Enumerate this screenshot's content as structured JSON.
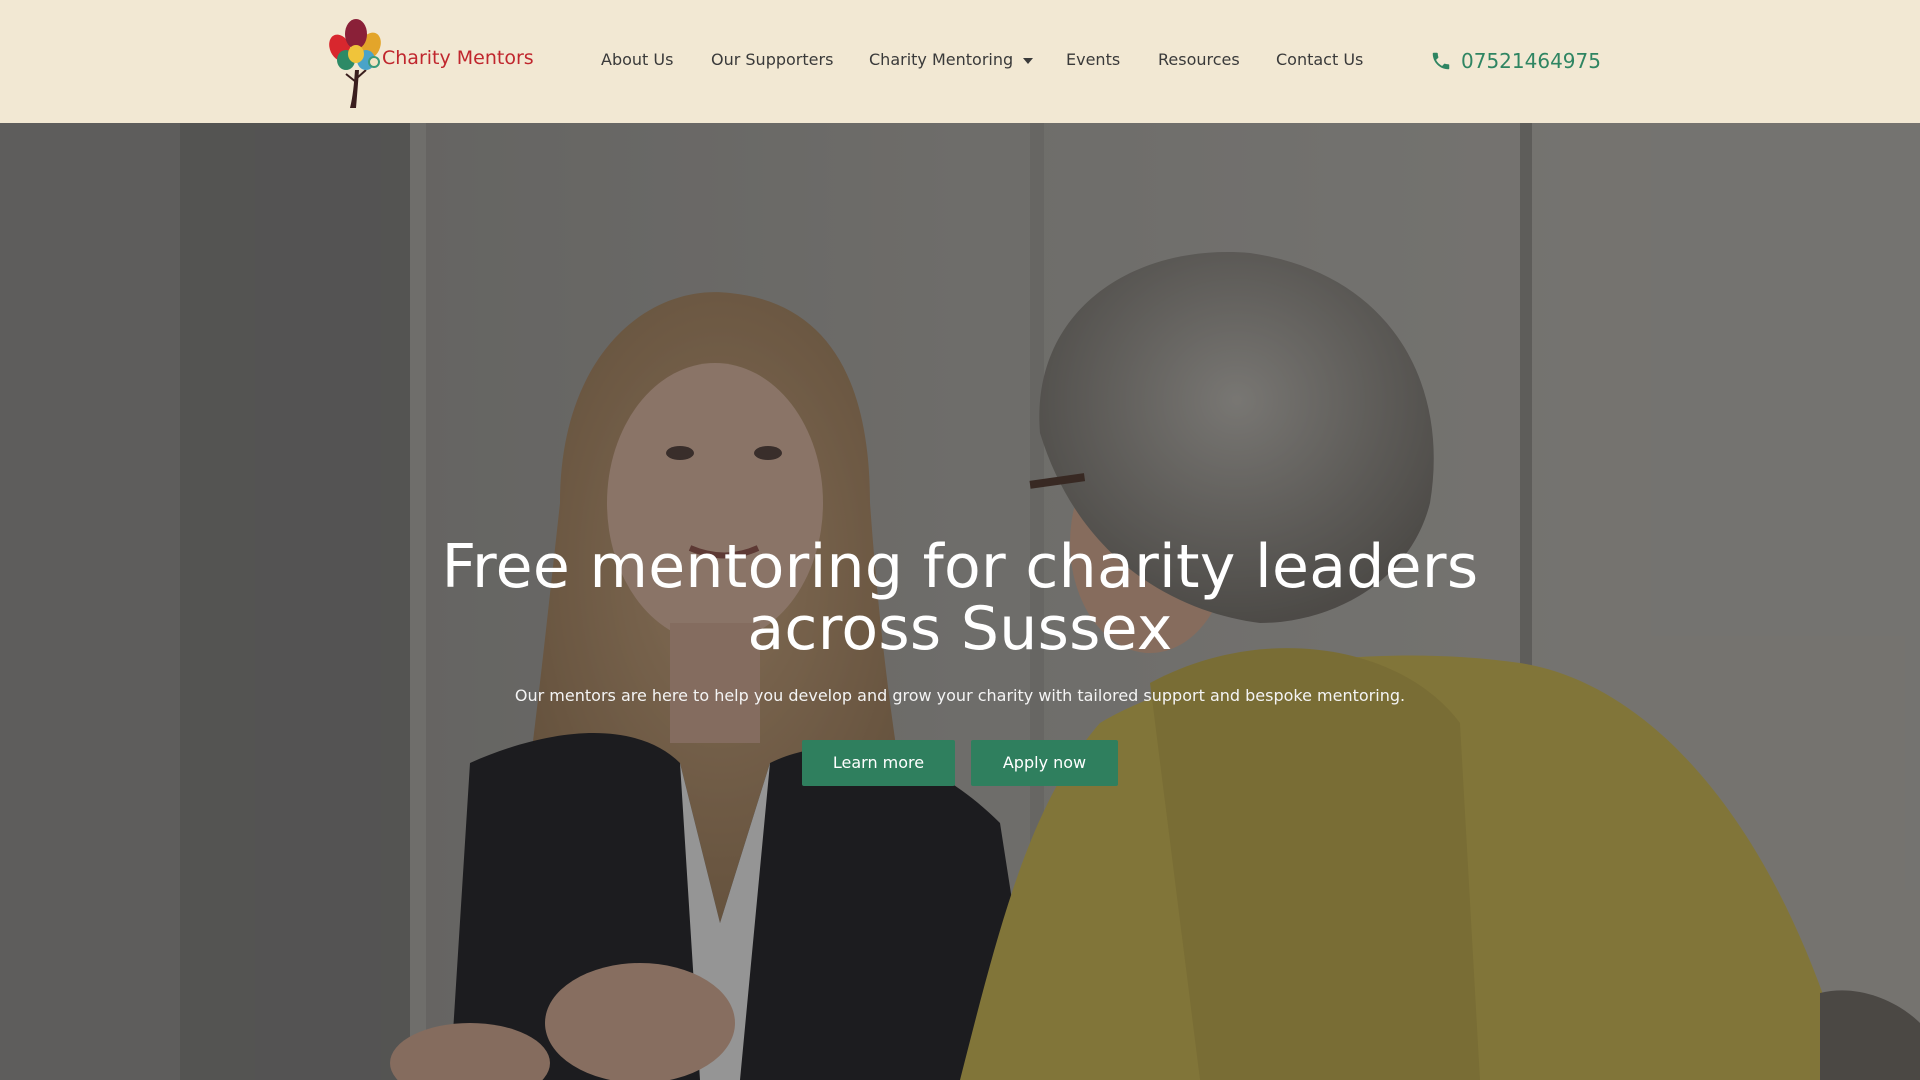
{
  "header": {
    "brand_name": "Charity Mentors",
    "logo_icon": "tree-of-hands-logo",
    "nav": [
      {
        "label": "About Us",
        "has_dropdown": false
      },
      {
        "label": "Our Supporters",
        "has_dropdown": false
      },
      {
        "label": "Charity Mentoring",
        "has_dropdown": true
      },
      {
        "label": "Events",
        "has_dropdown": false
      },
      {
        "label": "Resources",
        "has_dropdown": false
      },
      {
        "label": "Contact Us",
        "has_dropdown": false
      }
    ],
    "phone": {
      "number": "07521464975",
      "icon": "phone-icon"
    }
  },
  "hero": {
    "title": "Free mentoring for charity leaders across Sussex",
    "subtitle": "Our mentors are here to help you develop and grow your charity with tailored support and bespoke mentoring.",
    "buttons": {
      "learn_more": "Learn more",
      "apply_now": "Apply now"
    },
    "background_image": "two-women-mentoring-conversation-photo"
  },
  "colors": {
    "header_bg": "#f2e8d3",
    "brand": "#c0262d",
    "accent_green": "#2f7f5e",
    "phone_green": "#2f8562",
    "nav_text": "#3a3a3a"
  }
}
